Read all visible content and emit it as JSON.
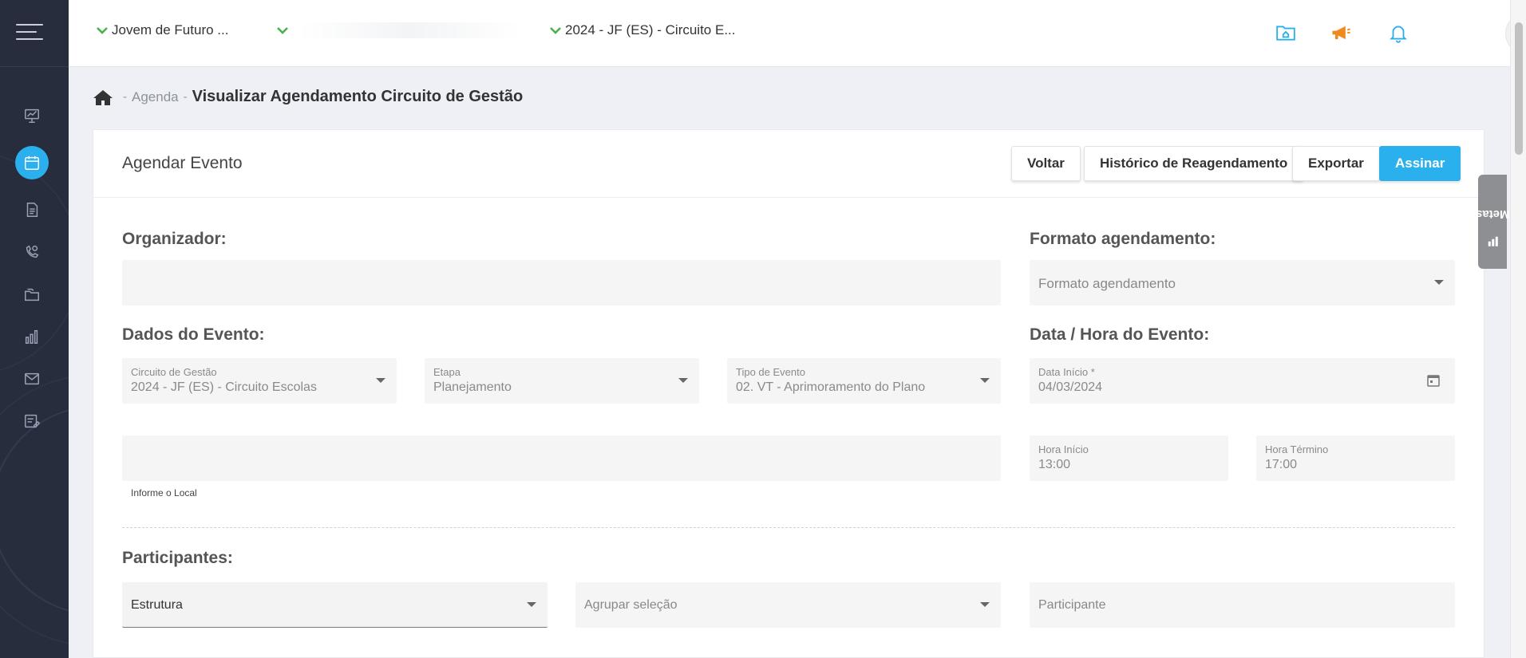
{
  "topbar": {
    "program_selector": "Jovem de Futuro ...",
    "region_selector": "",
    "circuit_selector": "2024 - JF (ES) - Circuito E...",
    "icons": [
      "folder-home-icon",
      "megaphone-icon",
      "bell-icon",
      "user-avatar-icon"
    ]
  },
  "sidebar": {
    "items": [
      {
        "icon": "presentation-chart-icon"
      },
      {
        "icon": "calendar-icon",
        "active": true
      },
      {
        "icon": "document-icon"
      },
      {
        "icon": "phone-user-icon"
      },
      {
        "icon": "folders-icon"
      },
      {
        "icon": "bar-chart-icon"
      },
      {
        "icon": "mail-icon"
      },
      {
        "icon": "list-edit-icon"
      }
    ]
  },
  "breadcrumb": {
    "sep1": "-",
    "agenda": "Agenda",
    "sep2": "-",
    "current": "Visualizar Agendamento Circuito de Gestão"
  },
  "card": {
    "title": "Agendar Evento",
    "buttons": {
      "back": "Voltar",
      "history": "Histórico de Reagendamento",
      "export": "Exportar",
      "sign": "Assinar"
    }
  },
  "form": {
    "organizer_label": "Organizador:",
    "format_label": "Formato agendamento:",
    "format_placeholder": "Formato agendamento",
    "event_data_label": "Dados do Evento:",
    "datetime_label": "Data / Hora do Evento:",
    "circuit": {
      "label": "Circuito de Gestão",
      "value": "2024 - JF (ES) - Circuito Escolas"
    },
    "stage": {
      "label": "Etapa",
      "value": "Planejamento"
    },
    "event_type": {
      "label": "Tipo de Evento",
      "value": "02. VT - Aprimoramento do Plano"
    },
    "start_date": {
      "label": "Data Início *",
      "value": "04/03/2024"
    },
    "local_helper": "Informe o Local",
    "start_time": {
      "label": "Hora Início",
      "value": "13:00"
    },
    "end_time": {
      "label": "Hora Término",
      "value": "17:00"
    },
    "participants_label": "Participantes:",
    "structure_placeholder": "Estrutura",
    "group_placeholder": "Agrupar seleção",
    "participant_placeholder": "Participante"
  },
  "side_tab": {
    "label": "Metas"
  },
  "colors": {
    "sidebar_bg": "#272d3d",
    "accent": "#2bb0ee",
    "check_green": "#4caf50",
    "megaphone_orange": "#f08a1c"
  }
}
